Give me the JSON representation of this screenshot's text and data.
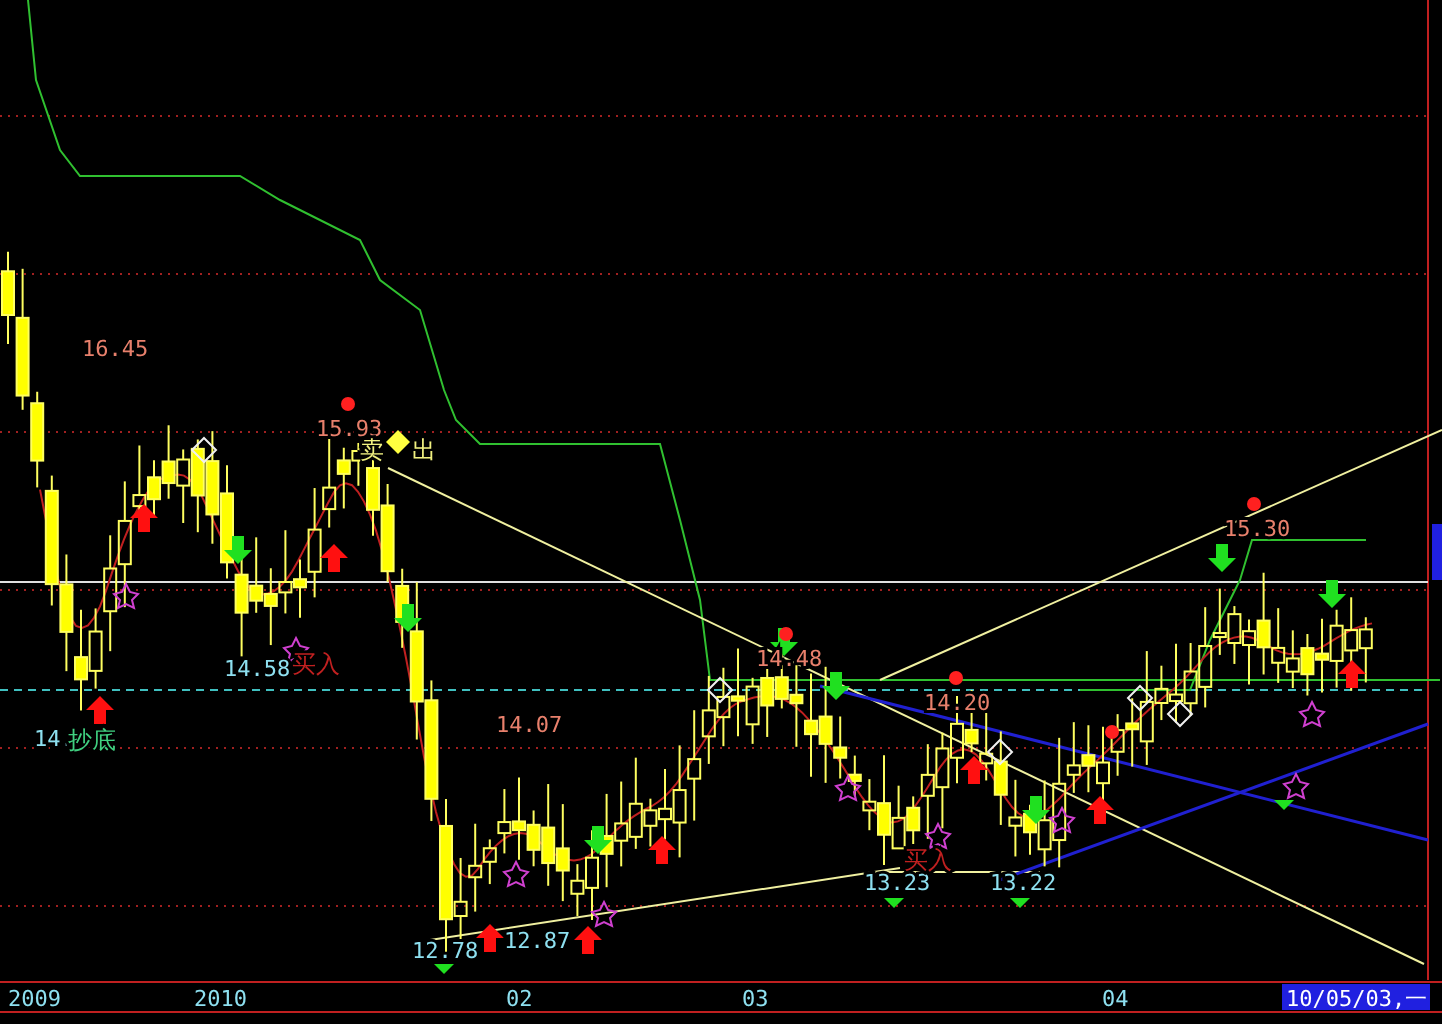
{
  "chart": {
    "labels": [
      {
        "text": "16.45",
        "kind": "high"
      },
      {
        "text": "15.93",
        "kind": "high"
      },
      {
        "text": "14.07",
        "kind": "high"
      },
      {
        "text": "14.48",
        "kind": "high"
      },
      {
        "text": "14.20",
        "kind": "high"
      },
      {
        "text": "15.30",
        "kind": "high"
      },
      {
        "text": "14.58",
        "kind": "low"
      },
      {
        "text": "14.",
        "kind": "low"
      },
      {
        "text": "12.78",
        "kind": "low"
      },
      {
        "text": "12.87",
        "kind": "low"
      },
      {
        "text": "13.23",
        "kind": "low"
      },
      {
        "text": "13.22",
        "kind": "low"
      },
      {
        "text": "抄底",
        "kind": "bottom"
      },
      {
        "text": "买入",
        "kind": "buy"
      },
      {
        "text": "买入",
        "kind": "buy"
      },
      {
        "text": "卖",
        "kind": "sell"
      },
      {
        "text": "出",
        "kind": "sell"
      }
    ]
  },
  "time_axis": {
    "labels": [
      "2009",
      "2010",
      "02",
      "03",
      "04"
    ],
    "cursor_date": "10/05/03,一"
  }
}
